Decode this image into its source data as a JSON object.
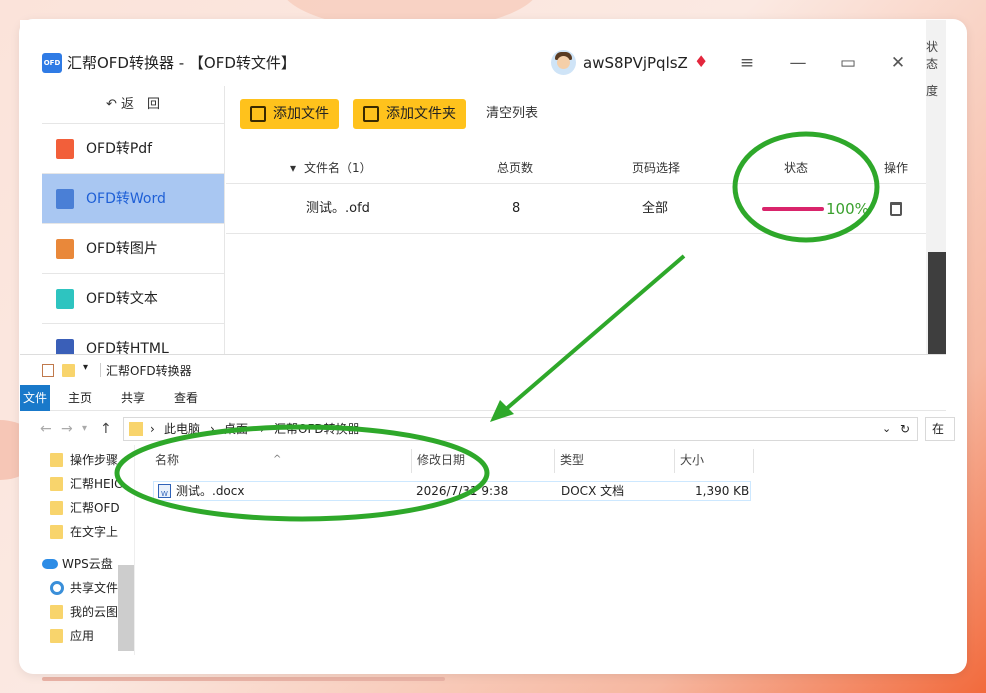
{
  "app": {
    "logo_text": "OFD",
    "title": "汇帮OFD转换器 - 【OFD转文件】",
    "username": "awS8PVjPqlsZ",
    "vip_icon": "diamond-icon",
    "window_controls": {
      "menu": "≡",
      "minimize": "—",
      "maximize": "▭",
      "close": "✕"
    }
  },
  "sidebar": {
    "back_label": "返　回",
    "items": [
      {
        "label": "OFD转Pdf",
        "icon": "pdf-icon",
        "color": "#f25f3a",
        "active": false
      },
      {
        "label": "OFD转Word",
        "icon": "word-icon",
        "color": "#4a7fd6",
        "active": true
      },
      {
        "label": "OFD转图片",
        "icon": "image-icon",
        "color": "#e9883a",
        "active": false
      },
      {
        "label": "OFD转文本",
        "icon": "text-icon",
        "color": "#2ec4c0",
        "active": false
      },
      {
        "label": "OFD转HTML",
        "icon": "html-icon",
        "color": "#3a5fb8",
        "active": false
      }
    ]
  },
  "toolbar": {
    "add_file": "添加文件",
    "add_folder": "添加文件夹",
    "clear_list": "清空列表"
  },
  "table": {
    "headers": {
      "filename": "文件名（1）",
      "pages": "总页数",
      "page_select": "页码选择",
      "status": "状态",
      "action": "操作"
    },
    "rows": [
      {
        "filename": "测试。.ofd",
        "pages": "8",
        "page_select": "全部",
        "progress": 100,
        "progress_text": "100%"
      }
    ]
  },
  "right_strip": {
    "line1": "状态",
    "line2": "度"
  },
  "explorer": {
    "title": "汇帮OFD转换器",
    "ribbon": {
      "file": "文件",
      "home": "主页",
      "share": "共享",
      "view": "查看"
    },
    "address": {
      "seg1": "此电脑",
      "seg2": "桌面",
      "seg3": "汇帮OFD转换器",
      "search_placeholder": "在"
    },
    "tree": [
      {
        "label": "操作步骤",
        "type": "folder"
      },
      {
        "label": "汇帮HEIC",
        "type": "folder"
      },
      {
        "label": "汇帮OFD",
        "type": "folder"
      },
      {
        "label": "在文字上",
        "type": "folder"
      },
      {
        "label": "WPS云盘",
        "type": "cloud"
      },
      {
        "label": "共享文件",
        "type": "share"
      },
      {
        "label": "我的云图",
        "type": "folder"
      },
      {
        "label": "应用",
        "type": "folder"
      }
    ],
    "columns": {
      "name": "名称",
      "date": "修改日期",
      "type": "类型",
      "size": "大小"
    },
    "files": [
      {
        "name": "测试。.docx",
        "date": "2026/7/31 9:38",
        "type": "DOCX 文档",
        "size": "1,390 KB"
      }
    ]
  },
  "colors": {
    "accent_yellow": "#ffc21c",
    "active_blue": "#a9c7f2",
    "annotation_green": "#2ea82a",
    "progress": "#d9246b"
  }
}
